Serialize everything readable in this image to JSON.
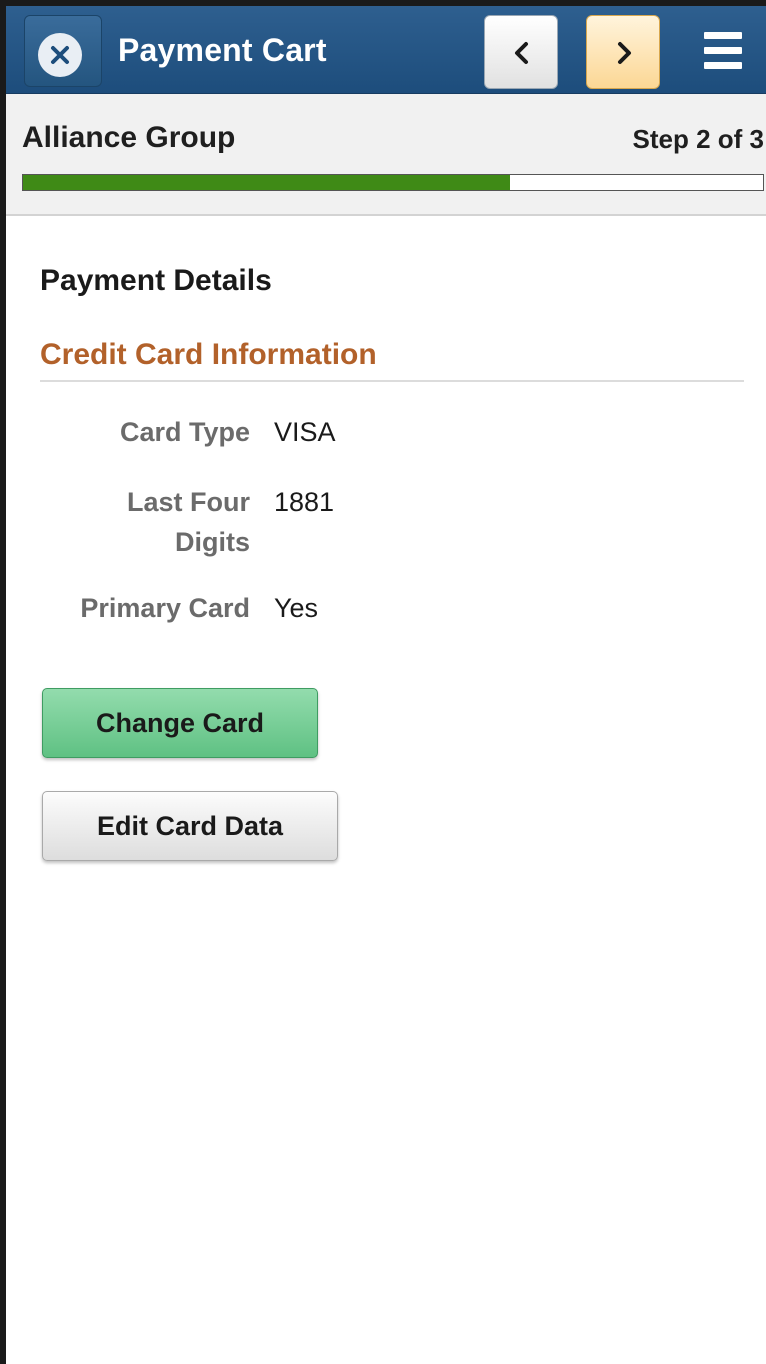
{
  "header": {
    "title": "Payment Cart",
    "close_icon": "close-icon",
    "prev_icon": "chevron-left-icon",
    "next_icon": "chevron-right-icon",
    "menu_icon": "hamburger-menu-icon"
  },
  "progress": {
    "group_name": "Alliance Group",
    "step_text": "Step 2 of 3",
    "fraction": 0.658,
    "color": "#3f8a16"
  },
  "payment_details": {
    "section_title": "Payment Details",
    "group_title": "Credit Card Information",
    "fields": [
      {
        "label": "Card Type",
        "value": "VISA"
      },
      {
        "label": "Last Four Digits",
        "value": "1881"
      },
      {
        "label": "Primary Card",
        "value": "Yes"
      }
    ]
  },
  "actions": {
    "change_card": "Change Card",
    "edit_card_data": "Edit Card Data"
  },
  "colors": {
    "header": "#1d4d7c",
    "group_title": "#b2612a",
    "primary_button": "#5fc183",
    "next_button": "#fcd795"
  }
}
